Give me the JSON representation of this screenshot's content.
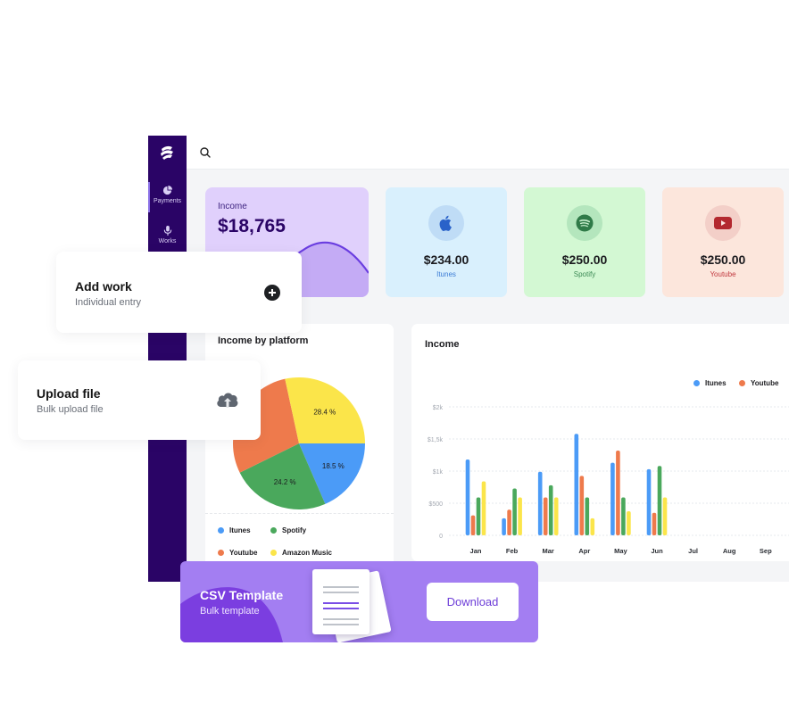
{
  "sidebar": {
    "items": [
      {
        "label": "Payments",
        "icon": "pie-chart-icon",
        "active": true
      },
      {
        "label": "Works",
        "icon": "microphone-icon",
        "active": false
      }
    ]
  },
  "topbar": {
    "search_icon": "search-icon"
  },
  "income_card": {
    "label": "Income",
    "value": "$18,765"
  },
  "platform_cards": [
    {
      "name": "Itunes",
      "amount": "$234.00",
      "icon": "apple-icon",
      "bg": "#d9f0fd",
      "circle": "#bfdcf6",
      "icon_color": "#2a62c9",
      "name_color": "#3a7bd5"
    },
    {
      "name": "Spotify",
      "amount": "$250.00",
      "icon": "spotify-icon",
      "bg": "#d3f8d3",
      "circle": "#b4e6bd",
      "icon_color": "#2f7a48",
      "name_color": "#3c8a55"
    },
    {
      "name": "Youtube",
      "amount": "$250.00",
      "icon": "youtube-icon",
      "bg": "#fce6dc",
      "circle": "#f3cfc8",
      "icon_color": "#b3282f",
      "name_color": "#c0373d"
    }
  ],
  "pie_panel": {
    "title": "Income by platform",
    "legend": [
      {
        "label": "Itunes",
        "color": "#4b9bf7"
      },
      {
        "label": "Spotify",
        "color": "#4aa85c"
      },
      {
        "label": "Youtube",
        "color": "#ee7a4c"
      },
      {
        "label": "Amazon Music",
        "color": "#fbe54a"
      }
    ]
  },
  "bar_panel": {
    "title": "Income",
    "legend": [
      {
        "label": "Itunes",
        "color": "#4b9bf7"
      },
      {
        "label": "Youtube",
        "color": "#ee7a4c"
      }
    ]
  },
  "chart_data": [
    {
      "type": "pie",
      "title": "Income by platform",
      "slices": [
        {
          "label": "Itunes",
          "value": 18.5,
          "display": "18.5 %",
          "color": "#4b9bf7"
        },
        {
          "label": "Spotify",
          "value": 24.2,
          "display": "24.2 %",
          "color": "#4aa85c"
        },
        {
          "label": "Youtube",
          "value": 28.9,
          "display": "",
          "color": "#ee7a4c"
        },
        {
          "label": "Amazon Music",
          "value": 28.4,
          "display": "28.4 %",
          "color": "#fbe54a"
        }
      ]
    },
    {
      "type": "bar",
      "title": "Income",
      "categories": [
        "Jan",
        "Feb",
        "Mar",
        "Apr",
        "May",
        "Jun",
        "Jul",
        "Aug",
        "Sep"
      ],
      "series": [
        {
          "name": "Itunes",
          "color": "#4b9bf7",
          "values": [
            1180,
            265,
            990,
            1580,
            1130,
            1030,
            null,
            null,
            null
          ]
        },
        {
          "name": "Youtube",
          "color": "#ee7a4c",
          "values": [
            310,
            400,
            590,
            925,
            1320,
            350,
            null,
            null,
            null
          ]
        },
        {
          "name": "Spotify",
          "color": "#4aa85c",
          "values": [
            590,
            730,
            780,
            590,
            590,
            1080,
            null,
            null,
            null
          ]
        },
        {
          "name": "Amazon Music",
          "color": "#fbe54a",
          "values": [
            840,
            590,
            590,
            265,
            375,
            590,
            null,
            null,
            null
          ]
        }
      ],
      "yticks": [
        {
          "v": 0,
          "label": "0"
        },
        {
          "v": 500,
          "label": "$500"
        },
        {
          "v": 1000,
          "label": "$1k"
        },
        {
          "v": 1500,
          "label": "$1,5k"
        },
        {
          "v": 2000,
          "label": "$2k"
        }
      ],
      "ylim": [
        0,
        2000
      ],
      "grid": true,
      "legend_position": "top-right",
      "xlabel": "",
      "ylabel": ""
    }
  ],
  "add_work": {
    "title": "Add work",
    "subtitle": "Individual entry",
    "icon": "plus-circle-icon"
  },
  "upload_file": {
    "title": "Upload file",
    "subtitle": "Bulk upload file",
    "icon": "cloud-upload-icon"
  },
  "csv_banner": {
    "title": "CSV Template",
    "subtitle": "Bulk template",
    "button": "Download"
  }
}
